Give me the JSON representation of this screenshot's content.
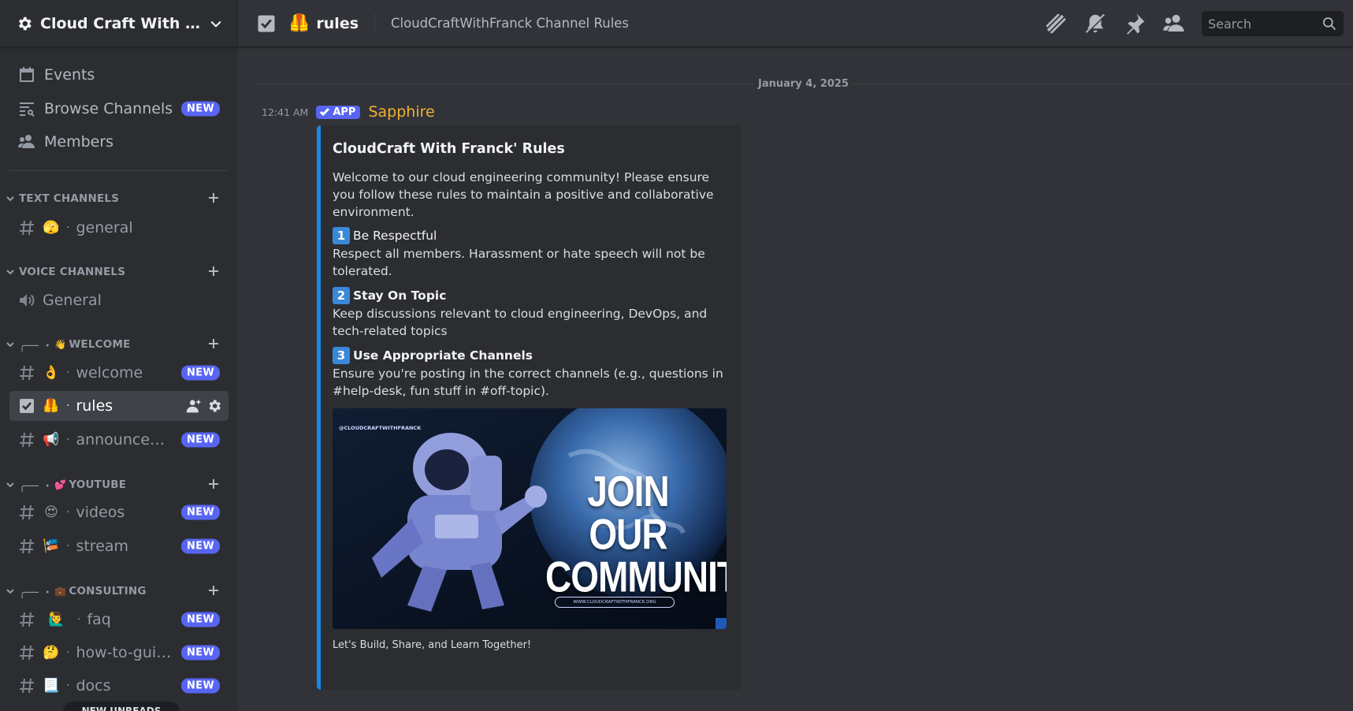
{
  "server": {
    "name": "Cloud Craft With Franck"
  },
  "sidebar": {
    "nav": [
      {
        "label": "Events",
        "icon": "calendar-icon"
      },
      {
        "label": "Browse Channels",
        "icon": "browse-channels-icon",
        "badge": "NEW"
      },
      {
        "label": "Members",
        "icon": "members-icon"
      }
    ],
    "categories": {
      "text": {
        "label": "TEXT CHANNELS"
      },
      "voice": {
        "label": "VOICE CHANNELS"
      },
      "welcome": {
        "prefix": "╭── ・",
        "emoji": "👋",
        "label": "WELCOME"
      },
      "youtube": {
        "prefix": "╭── ・",
        "emoji": "💕",
        "label": "YOUTUBE"
      },
      "consulting": {
        "prefix": "╭── ・",
        "emoji": "💼",
        "label": "CONSULTING"
      }
    },
    "channels": {
      "general_text": {
        "emoji": "🫣",
        "name": "general"
      },
      "general_voice": {
        "name": "General"
      },
      "welcome": {
        "emoji": "👌",
        "name": "welcome",
        "badge": "NEW"
      },
      "rules": {
        "emoji": "🦺",
        "name": "rules"
      },
      "announcements": {
        "emoji": "📢",
        "name": "announcements",
        "badge": "NEW"
      },
      "videos": {
        "emoji": "😍",
        "name": "videos",
        "badge": "NEW"
      },
      "stream": {
        "emoji": "🎏",
        "name": "stream",
        "badge": "NEW"
      },
      "faq": {
        "emoji": "🙋‍♂️",
        "name": "faq",
        "badge": "NEW"
      },
      "how_to": {
        "emoji": "🤔",
        "name": "how-to-guides",
        "badge": "NEW"
      },
      "docs": {
        "emoji": "📃",
        "name": "docs",
        "badge": "NEW"
      }
    },
    "new_unreads": "NEW UNREADS"
  },
  "topbar": {
    "channel_emoji": "🦺",
    "channel_name": "rules",
    "topic": "CloudCraftWithFranck Channel Rules",
    "search_placeholder": "Search",
    "tools": [
      "threads-icon",
      "mute-bell-icon",
      "pin-icon",
      "member-list-icon"
    ]
  },
  "messages": {
    "date": "January 4, 2025",
    "first": {
      "time": "12:41 AM",
      "tag": "APP",
      "author": "Sapphire",
      "author_color": "#f0b232",
      "embed": {
        "accent": "#1e88e5",
        "title": "CloudCraft With Franck' Rules",
        "description": "Welcome to our cloud engineering community! Please ensure you follow these rules to maintain a positive and collaborative environment.",
        "rules": [
          {
            "num": "1",
            "title": "Be Respectful",
            "text": "Respect all members. Harassment or hate speech will not be tolerated."
          },
          {
            "num": "2",
            "title": "Stay On Topic",
            "text": "Keep discussions relevant to cloud engineering, DevOps, and tech-related topics"
          },
          {
            "num": "3",
            "title": "Use Appropriate Channels",
            "text": "Ensure you're posting in the correct channels (e.g., questions in #help-desk, fun stuff in #off-topic)."
          }
        ],
        "image": {
          "headline": "JOIN OUR COMMUNITY",
          "handle": "@CLOUDCRAFTWITHFRANCK",
          "url": "WWW.CLOUDCRAFTWITHFRANCK.ORG"
        },
        "footer": "Let's Build, Share, and Learn Together!"
      }
    }
  }
}
